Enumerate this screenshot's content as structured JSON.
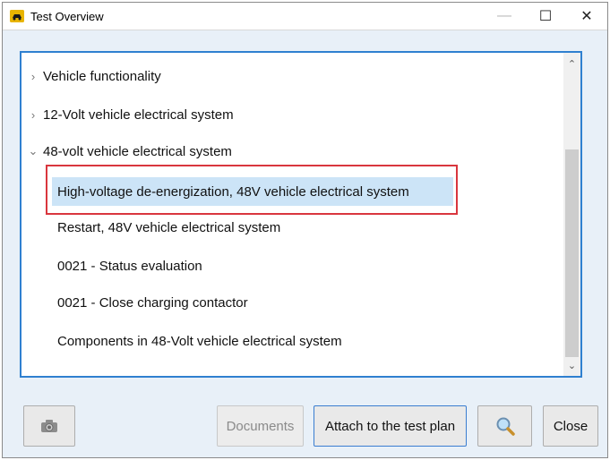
{
  "window": {
    "title": "Test Overview",
    "minimize_glyph": "—",
    "maximize_glyph": "☐",
    "close_glyph": "✕"
  },
  "tree": {
    "items": [
      {
        "label": "Vehicle functionality",
        "expanded": false
      },
      {
        "label": "12-Volt vehicle electrical system",
        "expanded": false
      },
      {
        "label": "48-volt vehicle electrical system",
        "expanded": true
      }
    ],
    "children": [
      {
        "label": "High-voltage de-energization, 48V vehicle electrical system",
        "selected": true
      },
      {
        "label": "Restart, 48V vehicle electrical system"
      },
      {
        "label": "0021  - Status evaluation"
      },
      {
        "label": "0021  - Close charging contactor"
      },
      {
        "label": "Components in 48-Volt vehicle electrical system"
      }
    ],
    "collapsed_glyph": "›",
    "expanded_glyph": "⌄"
  },
  "scrollbar": {
    "up_glyph": "⌃",
    "down_glyph": "⌄"
  },
  "buttons": {
    "camera_icon": "camera-icon",
    "documents": "Documents",
    "attach": "Attach to the test plan",
    "search_icon": "magnifier-icon",
    "close": "Close"
  },
  "colors": {
    "accent": "#2f80d0",
    "selection": "#cce4f7",
    "highlight": "#d9363e",
    "app_icon": "#e8b400"
  }
}
